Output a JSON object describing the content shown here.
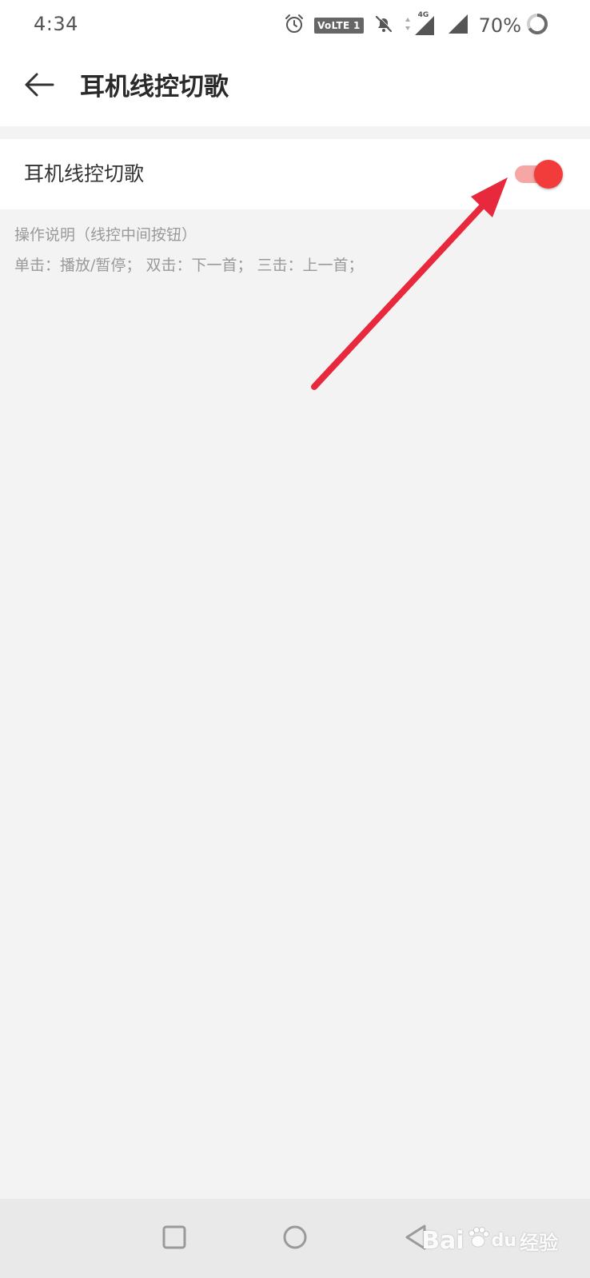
{
  "status_bar": {
    "time": "4:34",
    "volte": "VoLTE 1",
    "network": "4G",
    "battery": "70%",
    "icons": [
      "alarm-icon",
      "volte-icon",
      "mute-bell-icon",
      "data-arrows-icon",
      "signal-icon",
      "signal-icon",
      "battery-ring-icon"
    ]
  },
  "header": {
    "title": "耳机线控切歌",
    "back_icon": "back-arrow-icon"
  },
  "setting": {
    "label": "耳机线控切歌",
    "toggle_on": true,
    "accent_color": "#f23b3b",
    "track_color": "#f7a6a6"
  },
  "help": {
    "title": "操作说明（线控中间按钮）",
    "body": "单击：播放/暂停；  双击：下一首；  三击：上一首；"
  },
  "annotation": {
    "color": "#e8283c"
  },
  "nav_bar": {
    "buttons": [
      "recents-square-icon",
      "home-circle-icon",
      "back-triangle-icon"
    ]
  },
  "watermark": {
    "brand": "Bai",
    "paw": "du",
    "text": "经验"
  }
}
